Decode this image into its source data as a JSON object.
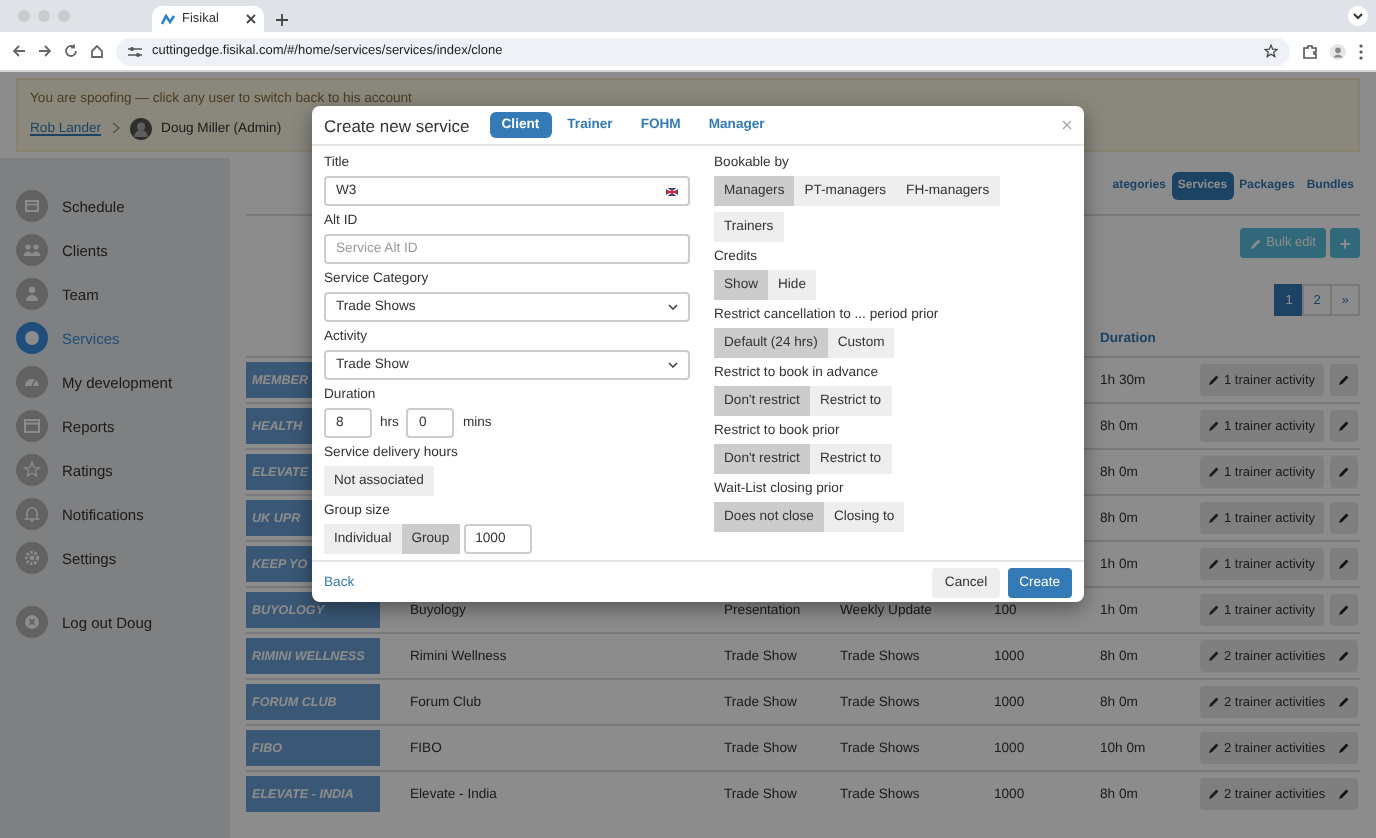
{
  "browser": {
    "tab_title": "Fisikal",
    "url": "cuttingedge.fisikal.com/#/home/services/services/index/clone"
  },
  "banner": {
    "text": "You are spoofing — click any user to switch back to his account",
    "user_link": "Rob Lander",
    "current_user": "Doug Miller (Admin)"
  },
  "sidebar": {
    "items": [
      {
        "label": "Schedule",
        "selected": false
      },
      {
        "label": "Clients",
        "selected": false
      },
      {
        "label": "Team",
        "selected": false
      },
      {
        "label": "Services",
        "selected": true
      },
      {
        "label": "My development",
        "selected": false
      },
      {
        "label": "Reports",
        "selected": false
      },
      {
        "label": "Ratings",
        "selected": false
      },
      {
        "label": "Notifications",
        "selected": false
      },
      {
        "label": "Settings",
        "selected": false
      }
    ],
    "logout": "Log out Doug"
  },
  "nav_tabs": [
    {
      "label": "ategories",
      "selected": false
    },
    {
      "label": "Services",
      "selected": true
    },
    {
      "label": "Packages",
      "selected": false
    },
    {
      "label": "Bundles",
      "selected": false
    }
  ],
  "toolbar": {
    "bulk_edit": "Bulk edit",
    "add": "+"
  },
  "pagination": [
    {
      "label": "1",
      "selected": true
    },
    {
      "label": "2",
      "selected": false
    },
    {
      "label": "»",
      "selected": false
    }
  ],
  "table": {
    "columns": [
      "Duration"
    ],
    "rows": [
      {
        "badge": "MEMBER",
        "duration": "1h 30m",
        "trainers": "1 trainer activity"
      },
      {
        "badge": "HEALTH",
        "duration": "8h 0m",
        "trainers": "1 trainer activity"
      },
      {
        "badge": "ELEVATE",
        "duration": "8h 0m",
        "trainers": "1 trainer activity"
      },
      {
        "badge": "UK UPR",
        "duration": "8h 0m",
        "trainers": "1 trainer activity"
      },
      {
        "badge": "KEEP YO",
        "duration": "1h 0m",
        "trainers": "1 trainer activity"
      },
      {
        "badge": "BUYOLOGY",
        "name": "Buyology",
        "activity": "Presentation",
        "category": "Weekly Update",
        "size": "100",
        "duration": "1h 0m",
        "trainers": "1 trainer activity"
      },
      {
        "badge": "RIMINI WELLNESS",
        "name": "Rimini Wellness",
        "activity": "Trade Show",
        "category": "Trade Shows",
        "size": "1000",
        "duration": "8h 0m",
        "trainers": "2 trainer activities"
      },
      {
        "badge": "FORUM CLUB",
        "name": "Forum Club",
        "activity": "Trade Show",
        "category": "Trade Shows",
        "size": "1000",
        "duration": "8h 0m",
        "trainers": "2 trainer activities"
      },
      {
        "badge": "FIBO",
        "name": "FIBO",
        "activity": "Trade Show",
        "category": "Trade Shows",
        "size": "1000",
        "duration": "10h 0m",
        "trainers": "2 trainer activities"
      },
      {
        "badge": "ELEVATE - INDIA",
        "name": "Elevate - India",
        "activity": "Trade Show",
        "category": "Trade Shows",
        "size": "1000",
        "duration": "8h 0m",
        "trainers": "2 trainer activities"
      }
    ]
  },
  "modal": {
    "title": "Create new service",
    "tabs": [
      {
        "label": "Client",
        "selected": true
      },
      {
        "label": "Trainer",
        "selected": false
      },
      {
        "label": "FOHM",
        "selected": false
      },
      {
        "label": "Manager",
        "selected": false
      }
    ],
    "title_field": {
      "label": "Title",
      "value": "W3"
    },
    "alt_id": {
      "label": "Alt ID",
      "placeholder": "Service Alt ID"
    },
    "service_category": {
      "label": "Service Category",
      "value": "Trade Shows"
    },
    "activity": {
      "label": "Activity",
      "value": "Trade Show"
    },
    "duration": {
      "label": "Duration",
      "hours": "8",
      "hours_unit": "hrs",
      "minutes": "0",
      "minutes_unit": "mins"
    },
    "delivery_hours": {
      "label": "Service delivery hours",
      "button": "Not associated"
    },
    "group_size": {
      "label": "Group size",
      "options": [
        {
          "label": "Individual",
          "selected": false
        },
        {
          "label": "Group",
          "selected": true
        }
      ],
      "value": "1000"
    },
    "choice_groups": [
      {
        "label": "Bookable by",
        "options": [
          {
            "label": "Managers",
            "selected": true
          },
          {
            "label": "PT-managers",
            "selected": false
          },
          {
            "label": "FH-managers",
            "selected": false
          },
          {
            "label": "Trainers",
            "selected": false
          }
        ]
      },
      {
        "label": "Credits",
        "options": [
          {
            "label": "Show",
            "selected": true
          },
          {
            "label": "Hide",
            "selected": false
          }
        ]
      },
      {
        "label": "Restrict cancellation to ... period prior",
        "options": [
          {
            "label": "Default (24 hrs)",
            "selected": true
          },
          {
            "label": "Custom",
            "selected": false
          }
        ]
      },
      {
        "label": "Restrict to book in advance",
        "options": [
          {
            "label": "Don't restrict",
            "selected": true
          },
          {
            "label": "Restrict to",
            "selected": false
          }
        ]
      },
      {
        "label": "Restrict to book prior",
        "options": [
          {
            "label": "Don't restrict",
            "selected": true
          },
          {
            "label": "Restrict to",
            "selected": false
          }
        ]
      },
      {
        "label": "Wait-List closing prior",
        "options": [
          {
            "label": "Does not close",
            "selected": true
          },
          {
            "label": "Closing to",
            "selected": false
          }
        ]
      }
    ],
    "back": "Back",
    "cancel": "Cancel",
    "create": "Create"
  }
}
